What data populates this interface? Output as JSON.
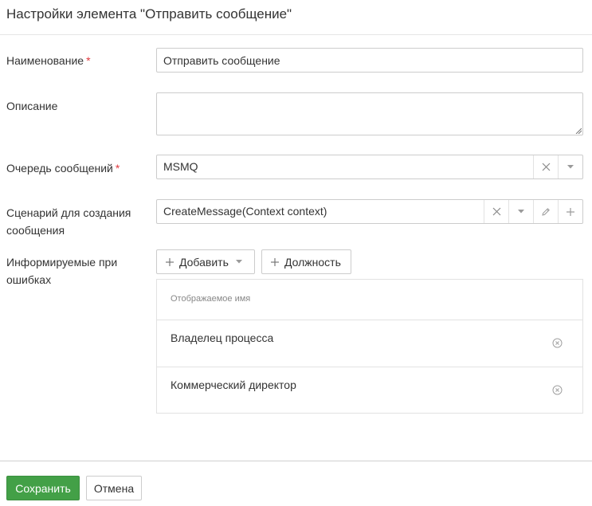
{
  "dialog": {
    "title": "Настройки элемента \"Отправить сообщение\""
  },
  "form": {
    "name": {
      "label": "Наименование",
      "required_mark": "*",
      "value": "Отправить сообщение"
    },
    "description": {
      "label": "Описание",
      "value": ""
    },
    "queue": {
      "label": "Очередь сообщений",
      "required_mark": "*",
      "value": "MSMQ",
      "clear_icon": "close-icon",
      "dropdown_icon": "caret-down-icon"
    },
    "script": {
      "label_line1": "Сценарий для создания",
      "label_line2": "сообщения",
      "value": "CreateMessage(Context context)",
      "clear_icon": "close-icon",
      "dropdown_icon": "caret-down-icon",
      "edit_icon": "pencil-icon",
      "add_icon": "plus-icon"
    },
    "notify": {
      "label_line1": "Информируемые при",
      "label_line2": "ошибках",
      "add_button": "Добавить",
      "position_button": "Должность",
      "grid": {
        "column_header": "Отображаемое имя",
        "rows": [
          {
            "name": "Владелец процесса"
          },
          {
            "name": "Коммерческий директор"
          }
        ]
      }
    }
  },
  "footer": {
    "save_label": "Сохранить",
    "cancel_label": "Отмена"
  },
  "colors": {
    "accent_green": "#43a047",
    "required_red": "#e0393e",
    "border": "#cccccc"
  }
}
